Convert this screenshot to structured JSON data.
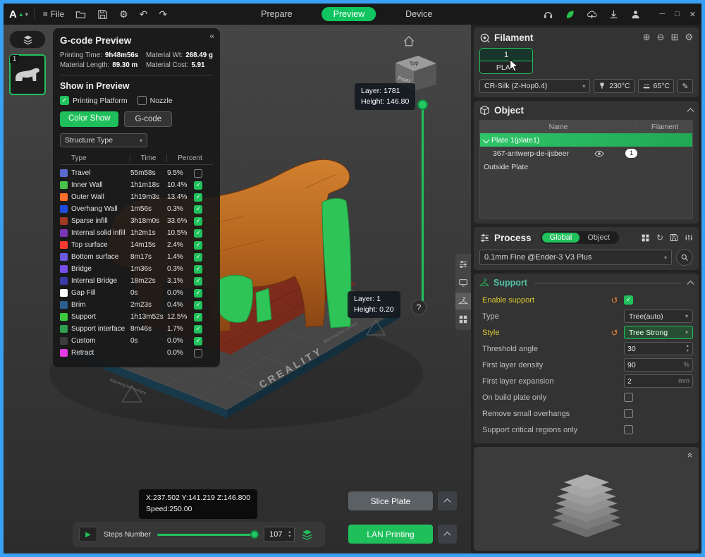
{
  "titlebar": {
    "logo": "A",
    "file": "File",
    "tabs": [
      {
        "label": "Prepare",
        "active": false
      },
      {
        "label": "Preview",
        "active": true
      },
      {
        "label": "Device",
        "active": false
      }
    ],
    "win_min": "─",
    "win_max": "□",
    "win_close": "✕"
  },
  "gcode": {
    "title": "G-code Preview",
    "collapse": "«",
    "stats": [
      {
        "label": "Printing Time:",
        "value": "9h48m56s"
      },
      {
        "label": "Material Wt:",
        "value": "268.49 g"
      },
      {
        "label": "Material Length:",
        "value": "89.30 m"
      },
      {
        "label": "Material Cost:",
        "value": "5.91"
      }
    ],
    "show_title": "Show in Preview",
    "show_platform": {
      "label": "Printing Platform",
      "checked": true
    },
    "show_nozzle": {
      "label": "Nozzle",
      "checked": false
    },
    "btn_color_show": "Color Show",
    "btn_gcode": "G-code",
    "structure_dropdown": "Structure Type",
    "headers": {
      "type": "Type",
      "time": "Time",
      "percent": "Percent"
    },
    "rows": [
      {
        "color": "#5a6acf",
        "type": "Travel",
        "time": "55m58s",
        "percent": "9.5%",
        "checked": false
      },
      {
        "color": "#49c24a",
        "type": "Inner Wall",
        "time": "1h1m18s",
        "percent": "10.4%",
        "checked": true
      },
      {
        "color": "#ff6f2a",
        "type": "Outer Wall",
        "time": "1h19m3s",
        "percent": "13.4%",
        "checked": true
      },
      {
        "color": "#1f4ce0",
        "type": "Overhang Wall",
        "time": "1m56s",
        "percent": "0.3%",
        "checked": true
      },
      {
        "color": "#a03a20",
        "type": "Sparse infill",
        "time": "3h18m0s",
        "percent": "33.6%",
        "checked": true
      },
      {
        "color": "#7a35b5",
        "type": "Internal solid infill",
        "time": "1h2m1s",
        "percent": "10.5%",
        "checked": true
      },
      {
        "color": "#ff3a30",
        "type": "Top surface",
        "time": "14m15s",
        "percent": "2.4%",
        "checked": true
      },
      {
        "color": "#6a5ae0",
        "type": "Bottom surface",
        "time": "8m17s",
        "percent": "1.4%",
        "checked": true
      },
      {
        "color": "#7a4ee8",
        "type": "Bridge",
        "time": "1m36s",
        "percent": "0.3%",
        "checked": true
      },
      {
        "color": "#3a3aa8",
        "type": "Internal Bridge",
        "time": "18m22s",
        "percent": "3.1%",
        "checked": true
      },
      {
        "color": "#ffffff",
        "type": "Gap Fill",
        "time": "0s",
        "percent": "0.0%",
        "checked": true
      },
      {
        "color": "#2a5f8f",
        "type": "Brim",
        "time": "2m23s",
        "percent": "0.4%",
        "checked": true
      },
      {
        "color": "#3dc93d",
        "type": "Support",
        "time": "1h13m52s",
        "percent": "12.5%",
        "checked": true
      },
      {
        "color": "#2e9e4f",
        "type": "Support interface",
        "time": "8m46s",
        "percent": "1.7%",
        "checked": true
      },
      {
        "color": "#3c3c3c",
        "type": "Custom",
        "time": "0s",
        "percent": "0.0%",
        "checked": true
      },
      {
        "color": "#e23ce2",
        "type": "Retract",
        "time": "",
        "percent": "0.0%",
        "checked": false
      }
    ]
  },
  "viewport": {
    "plate_number": "1",
    "plate_brand": "CREALITY",
    "plate_warning": "Warming hot surface",
    "cube_top": "Top",
    "cube_front": "Front",
    "layer_top": {
      "layer": "Layer: 1781",
      "height": "Height: 146.80"
    },
    "layer_bottom": {
      "layer": "Layer: 1",
      "height": "Height: 0.20"
    },
    "help": "?",
    "coords_line1": "X:237.502  Y:141.219  Z:146.800",
    "coords_line2": "Speed:250.00",
    "steps_label": "Steps Number",
    "steps_value": "107",
    "btn_slice": "Slice Plate",
    "btn_lan": "LAN Printing"
  },
  "filament": {
    "title": "Filament",
    "slot_number": "1",
    "slot_type": "PLA",
    "preset": "CR-Silk (Z-Hop0.4)",
    "nozzle_temp": "230°C",
    "bed_temp": "65°C"
  },
  "object": {
    "title": "Object",
    "col_name": "Name",
    "col_filament": "Filament",
    "row_plate": "Plate 1(plate1)",
    "row_model": "367-antwerp-de-ijsbeer",
    "row_model_badge": "1",
    "row_outside": "Outside Plate"
  },
  "process": {
    "title": "Process",
    "toggle_global": "Global",
    "toggle_object": "Object",
    "preset": "0.1mm Fine @Ender-3 V3 Plus"
  },
  "support": {
    "title": "Support",
    "rows": {
      "enable": {
        "label": "Enable support",
        "checked": true
      },
      "type": {
        "label": "Type",
        "value": "Tree(auto)"
      },
      "style": {
        "label": "Style",
        "value": "Tree Strong"
      },
      "threshold": {
        "label": "Threshold angle",
        "value": "30"
      },
      "density": {
        "label": "First layer density",
        "value": "90",
        "unit": "%"
      },
      "expansion": {
        "label": "First layer expansion",
        "value": "2",
        "unit": "mm"
      },
      "on_plate": {
        "label": "On build plate only",
        "checked": false
      },
      "remove_small": {
        "label": "Remove small overhangs",
        "checked": false
      },
      "critical": {
        "label": "Support critical regions only",
        "checked": false
      }
    }
  }
}
